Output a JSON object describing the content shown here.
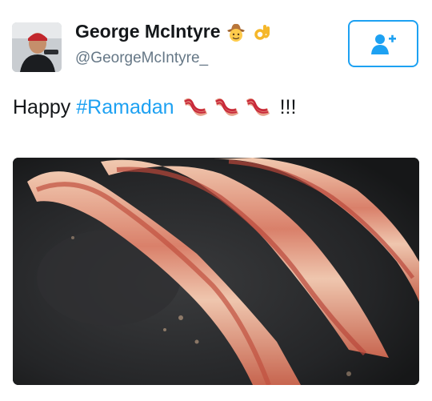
{
  "user": {
    "display_name": "George McIntyre",
    "handle": "@GeorgeMcIntyre_",
    "name_emojis": [
      "cowboy-face-icon",
      "ok-hand-icon"
    ]
  },
  "follow_button": {
    "icon": "add-user-icon",
    "accent": "#1da1f2"
  },
  "tweet": {
    "text_prefix": "Happy",
    "hashtag": "#Ramadan",
    "emojis": [
      "bacon-icon",
      "bacon-icon",
      "bacon-icon"
    ],
    "text_suffix": "!!!"
  },
  "media": {
    "subject": "bacon-in-pan-photo"
  },
  "colors": {
    "text": "#14171a",
    "secondary": "#657786",
    "link": "#1da1f2"
  }
}
